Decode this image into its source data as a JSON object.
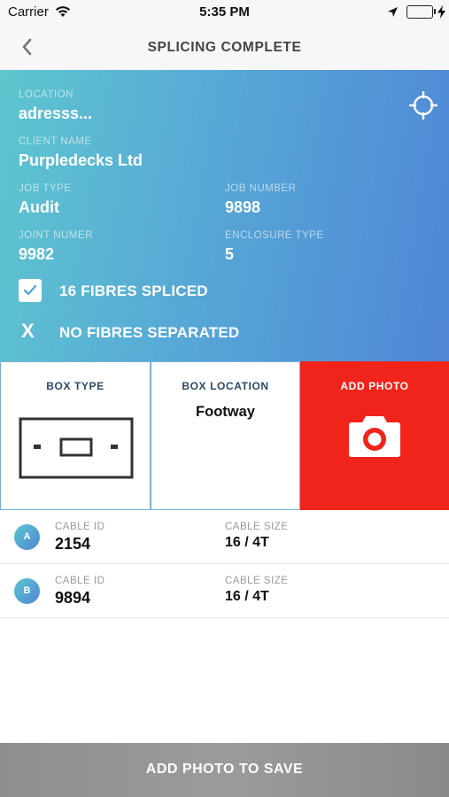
{
  "status_bar": {
    "carrier": "Carrier",
    "time": "5:35 PM",
    "icons": [
      "wifi-icon",
      "location-arrow-icon",
      "battery-icon",
      "charging-bolt-icon"
    ]
  },
  "nav": {
    "title": "SPLICING COMPLETE",
    "back_icon": "chevron-left-icon"
  },
  "info": {
    "location_label": "LOCATION",
    "location_value": "adresss...",
    "client_label": "CLIENT NAME",
    "client_value": "Purpledecks Ltd",
    "job_type_label": "JOB TYPE",
    "job_type_value": "Audit",
    "job_number_label": "JOB NUMBER",
    "job_number_value": "9898",
    "joint_label": "JOINT NUMER",
    "joint_value": "9982",
    "enclosure_label": "ENCLOSURE TYPE",
    "enclosure_value": "5",
    "fibres_spliced": "16 FIBRES SPLICED",
    "fibres_separated": "NO FIBRES SEPARATED",
    "separated_mark": "X",
    "target_icon": "crosshair-icon"
  },
  "tiles": {
    "box_type_label": "BOX TYPE",
    "box_location_label": "BOX LOCATION",
    "box_location_value": "Footway",
    "add_photo_label": "ADD PHOTO"
  },
  "cables": [
    {
      "badge": "A",
      "id_label": "CABLE ID",
      "id": "2154",
      "size_label": "CABLE SIZE",
      "size": "16 / 4T"
    },
    {
      "badge": "B",
      "id_label": "CABLE ID",
      "id": "9894",
      "size_label": "CABLE SIZE",
      "size": "16 / 4T"
    }
  ],
  "footer": {
    "save_label": "ADD PHOTO TO SAVE"
  },
  "colors": {
    "gradient_start": "#5ec6cf",
    "gradient_end": "#4f86d6",
    "photo_tile": "#f0241a",
    "save_button": "#939393"
  }
}
